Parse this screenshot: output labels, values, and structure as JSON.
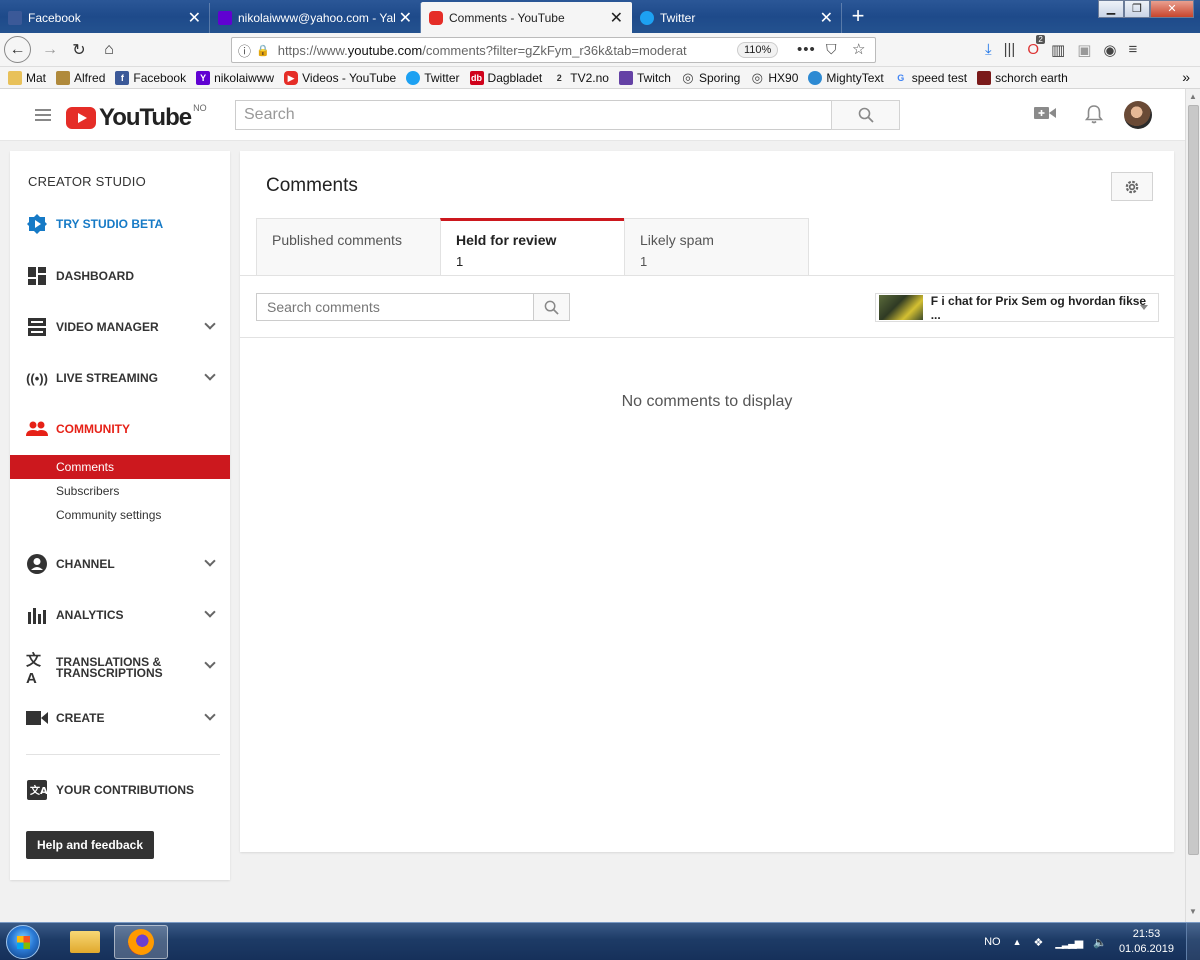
{
  "browser": {
    "tabs": [
      {
        "title": "Facebook",
        "icon": "facebook-icon",
        "color": "#3b5998"
      },
      {
        "title": "nikolaiwww@yahoo.com - Yah",
        "icon": "yahoo-mail-icon",
        "color": "#6001d2"
      },
      {
        "title": "Comments - YouTube",
        "icon": "youtube-icon",
        "color": "#e52d27"
      },
      {
        "title": "Twitter",
        "icon": "twitter-icon",
        "color": "#1da1f2"
      }
    ],
    "url_prefix": "https://www.",
    "url_domain": "youtube.com",
    "url_path": "/comments?filter=gZkFym_r36k&tab=moderat",
    "zoom": "110%",
    "badge_count": "2",
    "bookmarks": [
      {
        "label": "Mat",
        "icon": "folder-icon"
      },
      {
        "label": "Alfred",
        "icon": "alfred-icon"
      },
      {
        "label": "Facebook",
        "icon": "facebook-icon"
      },
      {
        "label": "nikolaiwww",
        "icon": "yahoo-icon"
      },
      {
        "label": "Videos - YouTube",
        "icon": "youtube-icon"
      },
      {
        "label": "Twitter",
        "icon": "twitter-icon"
      },
      {
        "label": "Dagbladet",
        "icon": "dagbladet-icon"
      },
      {
        "label": "TV2.no",
        "icon": "tv2-icon"
      },
      {
        "label": "Twitch",
        "icon": "twitch-icon"
      },
      {
        "label": "Sporing",
        "icon": "globe-icon"
      },
      {
        "label": "HX90",
        "icon": "globe-icon"
      },
      {
        "label": "MightyText",
        "icon": "mightytext-icon"
      },
      {
        "label": "speed test",
        "icon": "google-icon"
      },
      {
        "label": "schorch earth",
        "icon": "schorch-icon"
      }
    ]
  },
  "header": {
    "logo_text": "YouTube",
    "country_code": "NO",
    "search_placeholder": "Search"
  },
  "sidebar": {
    "heading": "CREATOR STUDIO",
    "beta": "TRY STUDIO BETA",
    "dashboard": "DASHBOARD",
    "video_manager": "VIDEO MANAGER",
    "live_streaming": "LIVE STREAMING",
    "community": "COMMUNITY",
    "community_items": [
      "Comments",
      "Subscribers",
      "Community settings"
    ],
    "channel": "CHANNEL",
    "analytics": "ANALYTICS",
    "translations_line1": "TRANSLATIONS &",
    "translations_line2": "TRANSCRIPTIONS",
    "create": "CREATE",
    "your_contributions": "YOUR CONTRIBUTIONS",
    "help_button": "Help and feedback"
  },
  "main": {
    "title": "Comments",
    "tabs": [
      {
        "label": "Published comments",
        "count": ""
      },
      {
        "label": "Held for review",
        "count": "1"
      },
      {
        "label": "Likely spam",
        "count": "1"
      }
    ],
    "search_placeholder": "Search comments",
    "video_title": "F i chat for Prix Sem og hvordan fikse ...",
    "empty_message": "No comments to display"
  },
  "taskbar": {
    "language": "NO",
    "time": "21:53",
    "date": "01.06.2019"
  }
}
